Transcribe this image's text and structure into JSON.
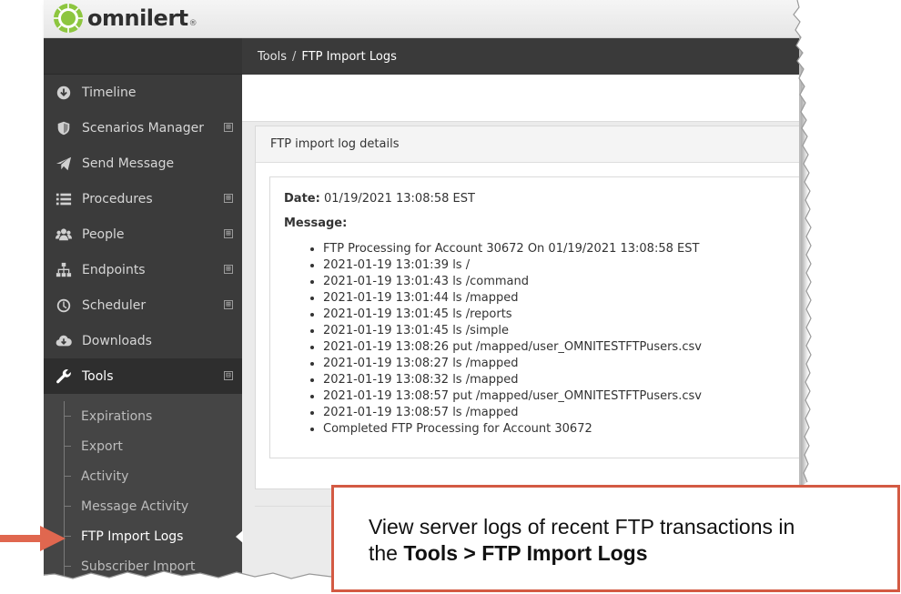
{
  "app": {
    "logo_text": "omnilert",
    "logo_reg": "®"
  },
  "breadcrumb": {
    "parent": "Tools",
    "separator": "/",
    "current": "FTP Import Logs"
  },
  "sidebar": {
    "items": [
      {
        "label": "Timeline",
        "icon": "download-circle-icon",
        "expandable": false
      },
      {
        "label": "Scenarios Manager",
        "icon": "shield-icon",
        "expandable": true
      },
      {
        "label": "Send Message",
        "icon": "paper-plane-icon",
        "expandable": false
      },
      {
        "label": "Procedures",
        "icon": "list-icon",
        "expandable": true
      },
      {
        "label": "People",
        "icon": "people-icon",
        "expandable": true
      },
      {
        "label": "Endpoints",
        "icon": "sitemap-icon",
        "expandable": true
      },
      {
        "label": "Scheduler",
        "icon": "clock-icon",
        "expandable": true
      },
      {
        "label": "Downloads",
        "icon": "cloud-download-icon",
        "expandable": false
      },
      {
        "label": "Tools",
        "icon": "wrench-icon",
        "expandable": true,
        "expanded": true
      }
    ],
    "expander_plus": "⊞",
    "expander_minus": "⊟",
    "tools_subitems": [
      {
        "label": "Expirations"
      },
      {
        "label": "Export"
      },
      {
        "label": "Activity"
      },
      {
        "label": "Message Activity"
      },
      {
        "label": "FTP Import Logs",
        "current": true
      },
      {
        "label": "Subscriber Import"
      }
    ]
  },
  "panel": {
    "heading": "FTP import log details",
    "date_label": "Date:",
    "date_value": "01/19/2021 13:08:58 EST",
    "message_label": "Message:",
    "log_lines": [
      "FTP Processing for Account 30672 On 01/19/2021 13:08:58 EST",
      "2021-01-19 13:01:39 ls /",
      "2021-01-19 13:01:43 ls /command",
      "2021-01-19 13:01:44 ls /mapped",
      "2021-01-19 13:01:45 ls /reports",
      "2021-01-19 13:01:45 ls /simple",
      "2021-01-19 13:08:26 put /mapped/user_OMNITESTFTPusers.csv",
      "2021-01-19 13:08:27 ls /mapped",
      "2021-01-19 13:08:32 ls /mapped",
      "2021-01-19 13:08:57 put /mapped/user_OMNITESTFTPusers.csv",
      "2021-01-19 13:08:57 ls /mapped",
      "Completed FTP Processing for Account 30672"
    ]
  },
  "callout": {
    "text_line1": "View server logs of recent FTP transactions in",
    "text_prefix": "the ",
    "text_bold": "Tools > FTP Import Logs"
  },
  "colors": {
    "sidebar_bg": "#3b3b3b",
    "callout_border": "#d35a43",
    "arrow": "#e0674f",
    "logo_green": "#8dc63f"
  }
}
